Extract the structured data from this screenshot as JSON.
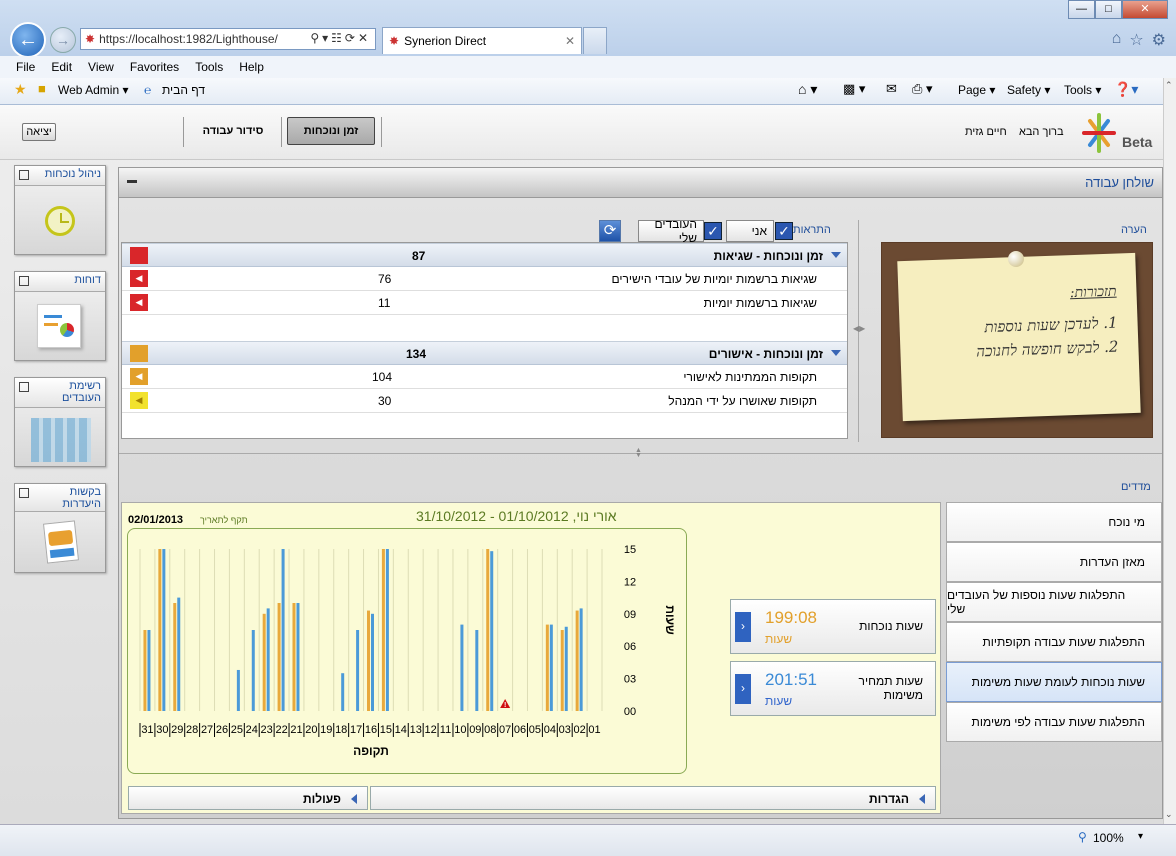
{
  "browser": {
    "url": "https://localhost:1982/Lighthouse/",
    "tab_title": "Synerion Direct",
    "menu": [
      "File",
      "Edit",
      "View",
      "Favorites",
      "Tools",
      "Help"
    ],
    "favorites": {
      "web_admin": "Web Admin",
      "home_link": "דף הבית"
    },
    "commands": {
      "page": "Page",
      "safety": "Safety",
      "tools": "Tools"
    },
    "zoom": "100%"
  },
  "app": {
    "logout": "יציאה",
    "tabs": {
      "time": "זמן ונוכחות",
      "schedule": "סידור עבודה"
    },
    "welcome": "ברוך הבא",
    "user": "חיים גזית",
    "logo_text": "Beta",
    "sidebar": [
      {
        "label": "ניהול נוכחות"
      },
      {
        "label": "דוחות"
      },
      {
        "label": "רשימת העובדים"
      },
      {
        "label": "בקשות היעדרות"
      }
    ]
  },
  "workdesk": {
    "title": "שולחן עבודה",
    "alerts_label": "התראות",
    "filter_me": "אני",
    "filter_my_employees": "העובדים שלי",
    "note_label": "הערה",
    "groups": [
      {
        "label": "זמן ונוכחות - שגיאות",
        "count": "87",
        "color": "#d9262a",
        "rows": [
          {
            "label": "שגיאות ברשמות יומיות של עובדי הישירים",
            "count": "76",
            "color": "#d9262a"
          },
          {
            "label": "שגיאות ברשמות יומיות",
            "count": "11",
            "color": "#d9262a"
          }
        ]
      },
      {
        "label": "זמן ונוכחות - אישורים",
        "count": "134",
        "color": "#e2a02b",
        "rows": [
          {
            "label": "תקופות הממתינות לאישורי",
            "count": "104",
            "color": "#e2a02b"
          },
          {
            "label": "תקופות שאושרו על ידי המנהל",
            "count": "30",
            "color": "#f2e22d"
          }
        ]
      }
    ],
    "note": {
      "title": "תזכורות:",
      "line1": "1. לעדכן שעות נוספות",
      "line2": "2. לבקש חופשה לחנוכה"
    }
  },
  "measures": {
    "label": "מדדים",
    "items": [
      "מי נוכח",
      "מאזן העדרות",
      "התפלגות שעות נוספות של העובדים שלי",
      "התפלגות שעות עבודה תקופתיות",
      "שעות נוכחות לעומת שעות משימות",
      "התפלגות שעות עבודה לפי משימות"
    ],
    "selected_index": 4,
    "chart_header": "אורי נוי, 01/10/2012 - 31/10/2012",
    "valid_label": "תקף לתאריך",
    "valid_date": "02/01/2013",
    "kpis": [
      {
        "name": "שעות נוכחות",
        "value": "199:08",
        "unit": "שעות",
        "color": "#e2a02b"
      },
      {
        "name": "שעות תמחיר משימות",
        "value": "201:51",
        "unit": "שעות",
        "color": "#3a8ad6"
      }
    ],
    "footer": {
      "settings": "הגדרות",
      "actions": "פעולות"
    }
  },
  "chart_data": {
    "type": "bar",
    "xlabel": "תקופה",
    "ylabel": "שעות",
    "ylim": [
      0,
      15
    ],
    "yticks": [
      "00",
      "03",
      "06",
      "09",
      "12",
      "15"
    ],
    "categories": [
      "01",
      "02",
      "03",
      "04",
      "05",
      "06",
      "07",
      "08",
      "09",
      "10",
      "11",
      "12",
      "13",
      "14",
      "15",
      "16",
      "17",
      "18",
      "19",
      "20",
      "21",
      "22",
      "23",
      "24",
      "25",
      "26",
      "27",
      "28",
      "29",
      "30",
      "31"
    ],
    "series": [
      {
        "values": [
          0,
          9.3,
          7.5,
          8,
          0,
          0,
          0,
          15,
          0,
          0,
          0,
          0,
          0,
          0,
          15,
          9.3,
          0,
          0,
          0,
          0,
          10,
          10,
          9,
          0,
          0,
          0,
          0,
          0,
          10,
          15,
          7.5
        ],
        "color": "#e8a93c"
      },
      {
        "values": [
          0,
          9.5,
          7.8,
          8,
          0,
          0,
          0,
          14.8,
          7.5,
          8,
          0,
          0,
          0,
          0,
          15,
          9,
          7.5,
          3.5,
          0,
          0,
          10,
          15,
          9.5,
          7.5,
          3.8,
          0,
          0,
          0,
          10.5,
          15,
          7.5
        ],
        "color": "#4b9ad8"
      }
    ],
    "annotations": [
      {
        "category": "07",
        "marker": "warning-icon",
        "color": "#d01010"
      }
    ]
  }
}
